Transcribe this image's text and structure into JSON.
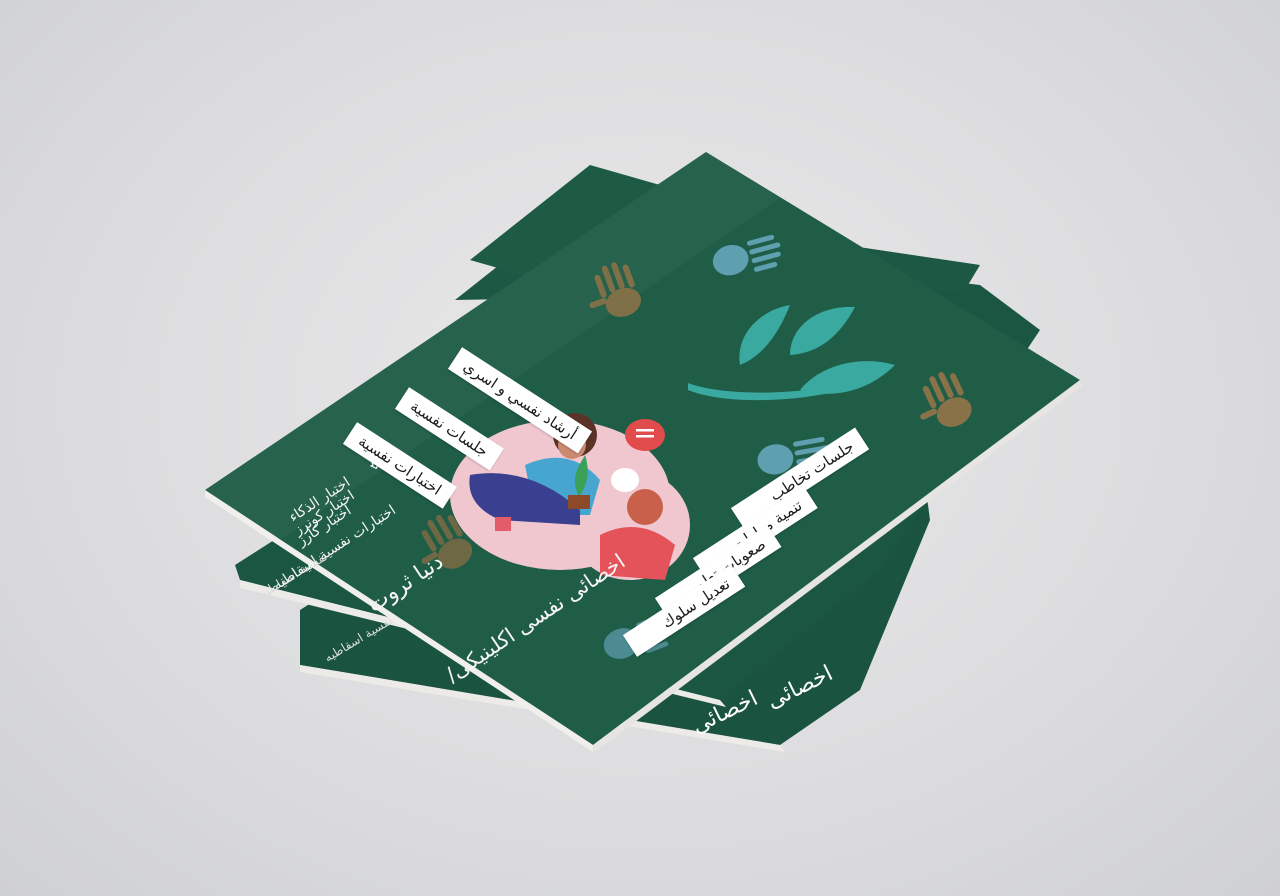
{
  "background_color": "#dcdcde",
  "cover_color": "#1f5d47",
  "accent_teal": "#3aa9a0",
  "hand_brown": "#8a7248",
  "hand_blue": "#5e9fb0",
  "left_labels": [
    "أرشاد نفسي و اسري",
    "جلسات نفسية",
    "اختبارات نفسية"
  ],
  "test_list": [
    "اختبار الذكاء",
    "اختبار كونرز",
    "اختبار كارز",
    "اختبارات نفسية اسقاطيه"
  ],
  "right_labels": [
    "جلسات تخاطب",
    "تنمية مهارات",
    "صعوبات تعلم",
    "تعديل سلوك"
  ],
  "name_line": "دنيا ثروت",
  "title_line": "اخصائى نفسى اكلينيكى/",
  "back_fragments": {
    "booklet2_title": "اخصائى",
    "booklet3_title": "اخصائى",
    "booklet2_list": "نفسية اسقاطيه",
    "booklet3_list": "نفسية اسقاطيه"
  },
  "icons": [
    "hand-print-icon",
    "leaf-logo-icon",
    "arrow-down-icon",
    "speech-bubble-icon"
  ]
}
